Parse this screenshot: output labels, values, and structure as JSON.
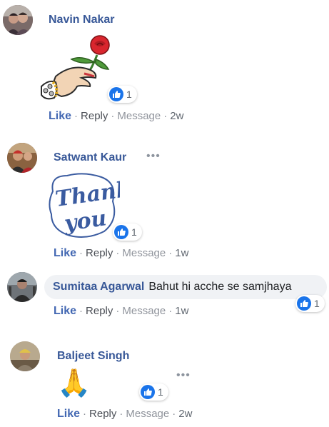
{
  "comments": [
    {
      "author": "Navin Nakar",
      "sticker": "rose-in-hand-sticker",
      "reactions": {
        "icon": "thumbs-up-icon",
        "count": "1"
      },
      "actions": {
        "like": "Like",
        "reply": "Reply",
        "message": "Message",
        "time": "2w"
      }
    },
    {
      "author": "Satwant Kaur",
      "sticker": "thank-you-sticker",
      "sticker_text_line1": "Thank",
      "sticker_text_line2": "you",
      "more_icon": "more-dots-icon",
      "reactions": {
        "icon": "thumbs-up-icon",
        "count": "1"
      },
      "actions": {
        "like": "Like",
        "reply": "Reply",
        "message": "Message",
        "time": "1w"
      }
    },
    {
      "author": "Sumitaa Agarwal",
      "text": "Bahut hi acche se samjhaya",
      "reactions": {
        "icon": "thumbs-up-icon",
        "count": "1"
      },
      "actions": {
        "like": "Like",
        "reply": "Reply",
        "message": "Message",
        "time": "1w"
      }
    },
    {
      "author": "Baljeet Singh",
      "emoji": "🙏",
      "more_icon": "more-dots-icon",
      "reactions": {
        "icon": "thumbs-up-icon",
        "count": "1"
      },
      "actions": {
        "like": "Like",
        "reply": "Reply",
        "message": "Message",
        "time": "2w"
      }
    }
  ],
  "colors": {
    "name": "#385898",
    "like": "#4267b2",
    "meta": "#90949c",
    "bubble": "#f0f2f5",
    "reaction_blue": "#1a74ea",
    "sticker_blue": "#3a5ba0"
  },
  "separator": "·"
}
